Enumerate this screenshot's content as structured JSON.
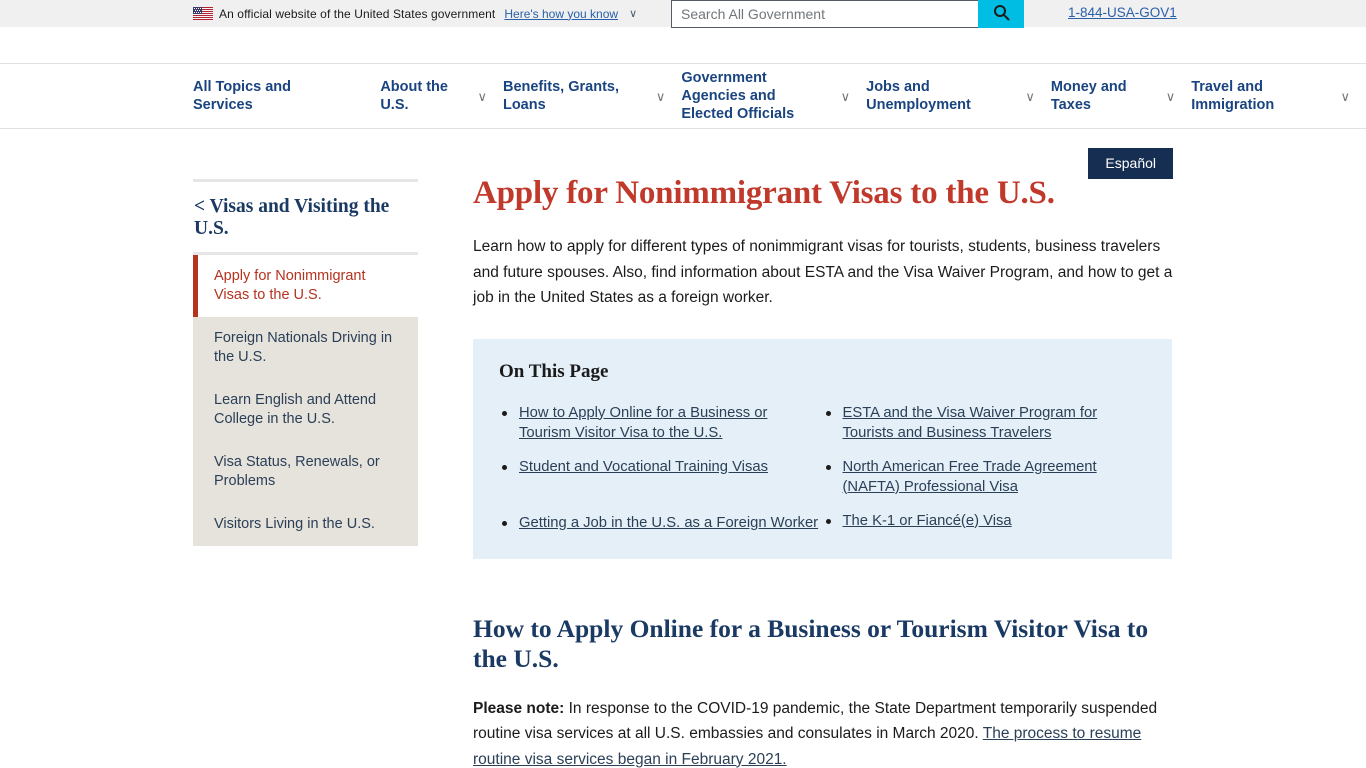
{
  "banner": {
    "flag_icon": "us-flag-icon",
    "text": "An official website of the United States government",
    "link": "Here's how you know",
    "caret": "∨"
  },
  "search": {
    "placeholder": "Search All Government",
    "value": "",
    "icon": "search-icon"
  },
  "phone": "1-844-USA-GOV1",
  "nav": {
    "items": [
      {
        "label": "All Topics and Services",
        "has_caret": false
      },
      {
        "label": "About the U.S.",
        "has_caret": true
      },
      {
        "label": "Benefits, Grants, Loans",
        "has_caret": true
      },
      {
        "label": "Government Agencies and Elected Officials",
        "has_caret": true
      },
      {
        "label": "Jobs and Unemployment",
        "has_caret": true
      },
      {
        "label": "Money and Taxes",
        "has_caret": true
      },
      {
        "label": "Travel and Immigration",
        "has_caret": true
      }
    ],
    "caret": "∨"
  },
  "espanol_button": "Español",
  "sidebar": {
    "parent_title": "< Visas and Visiting the U.S.",
    "items": [
      {
        "label": "Apply for Nonimmigrant Visas to the U.S.",
        "active": true
      },
      {
        "label": "Foreign Nationals Driving in the U.S.",
        "active": false
      },
      {
        "label": "Learn English and Attend College in the U.S.",
        "active": false
      },
      {
        "label": "Visa Status, Renewals, or Problems",
        "active": false
      },
      {
        "label": "Visitors Living in the U.S.",
        "active": false
      }
    ]
  },
  "main": {
    "title": "Apply for Nonimmigrant Visas to the U.S.",
    "intro": "Learn how to apply for different types of nonimmigrant visas for tourists, students, business travelers and future spouses. Also, find information about ESTA and the Visa Waiver Program, and how to get a job in the United States as a foreign worker.",
    "on_this_page": {
      "title": "On This Page",
      "left_links": [
        "How to Apply Online for a Business or Tourism Visitor Visa to the U.S.",
        "Student and Vocational Training Visas",
        "Getting a Job in the U.S. as a Foreign Worker"
      ],
      "right_links": [
        "ESTA and the Visa Waiver Program for Tourists and Business Travelers",
        "North American Free Trade Agreement (NAFTA) Professional Visa",
        "The K-1 or Fiancé(e) Visa"
      ]
    },
    "section": {
      "heading": "How to Apply Online for a Business or Tourism Visitor Visa to the U.S.",
      "note_label": "Please note:",
      "note_body": "In response to the COVID-19 pandemic, the State Department temporarily suspended routine visa services at all U.S. embassies and consulates in March 2020.",
      "note_link": "The process to resume routine visa services began in February 2021."
    }
  },
  "colors": {
    "brand_navy": "#162e51",
    "nav_blue": "#1a4480",
    "title_red": "#c0392b",
    "accent_cyan": "#00bde3",
    "sidebar_bg": "#e6e2dc",
    "otp_bg": "#e5eff7",
    "active_red": "#b5331f"
  }
}
